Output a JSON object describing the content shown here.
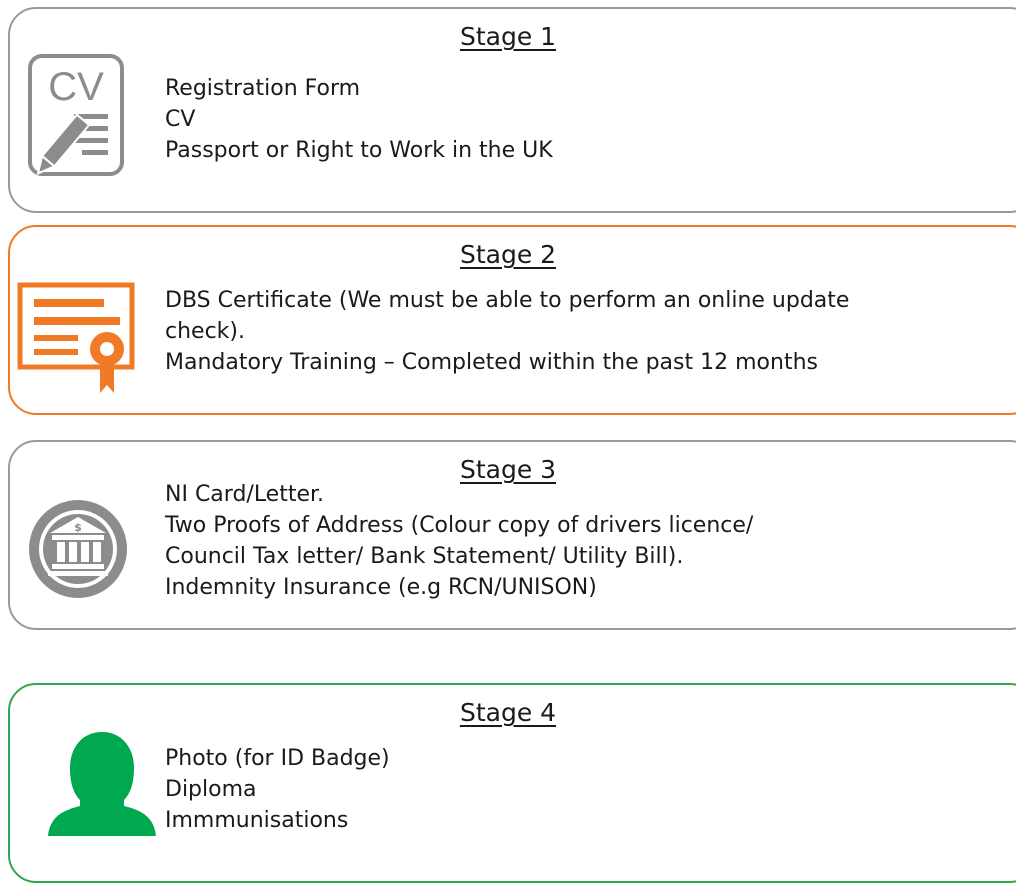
{
  "colors": {
    "stage1_border": "#9a9a9a",
    "stage2_border": "#f07a26",
    "stage3_border": "#9a9a9a",
    "stage4_border": "#2ea84a"
  },
  "stages": [
    {
      "title": "Stage 1",
      "icon": "cv-document-pencil-icon",
      "icon_text": "CV",
      "items": [
        "Registration Form",
        "CV",
        "Passport or Right to Work in the UK"
      ]
    },
    {
      "title": "Stage 2",
      "icon": "certificate-icon",
      "items": [
        "DBS Certificate (We must be able to perform an online update",
        "check).",
        "Mandatory Training – Completed within the past 12 months"
      ]
    },
    {
      "title": "Stage 3",
      "icon": "bank-icon",
      "items": [
        "NI Card/Letter.",
        "Two Proofs of Address (Colour copy of drivers licence/",
        "Council Tax letter/ Bank Statement/ Utility Bill).",
        "Indemnity Insurance (e.g RCN/UNISON)"
      ]
    },
    {
      "title": "Stage 4",
      "icon": "person-silhouette-icon",
      "items": [
        "Photo (for ID Badge)",
        "Diploma",
        "Immmunisations"
      ]
    }
  ]
}
